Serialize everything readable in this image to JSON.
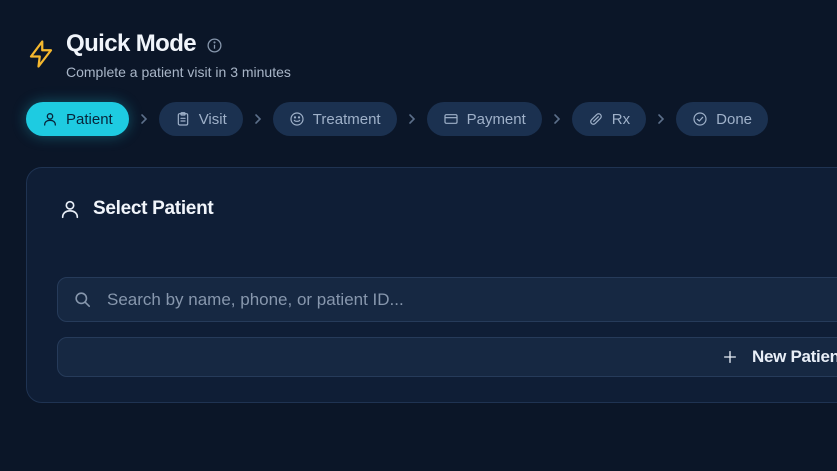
{
  "header": {
    "title": "Quick Mode",
    "subtitle": "Complete a patient visit in 3 minutes"
  },
  "stepper": {
    "steps": [
      {
        "label": "Patient",
        "icon": "user-icon",
        "active": true
      },
      {
        "label": "Visit",
        "icon": "clipboard-icon",
        "active": false
      },
      {
        "label": "Treatment",
        "icon": "smile-icon",
        "active": false
      },
      {
        "label": "Payment",
        "icon": "credit-card-icon",
        "active": false
      },
      {
        "label": "Rx",
        "icon": "pill-icon",
        "active": false
      },
      {
        "label": "Done",
        "icon": "check-circle-icon",
        "active": false
      }
    ]
  },
  "patient_card": {
    "title": "Select Patient",
    "search_placeholder": "Search by name, phone, or patient ID...",
    "new_patient_label": "New Patient"
  },
  "colors": {
    "background": "#0b1628",
    "accent": "#1ecbe1",
    "bolt": "#f5b82e",
    "step_inactive": "#1b3150"
  }
}
